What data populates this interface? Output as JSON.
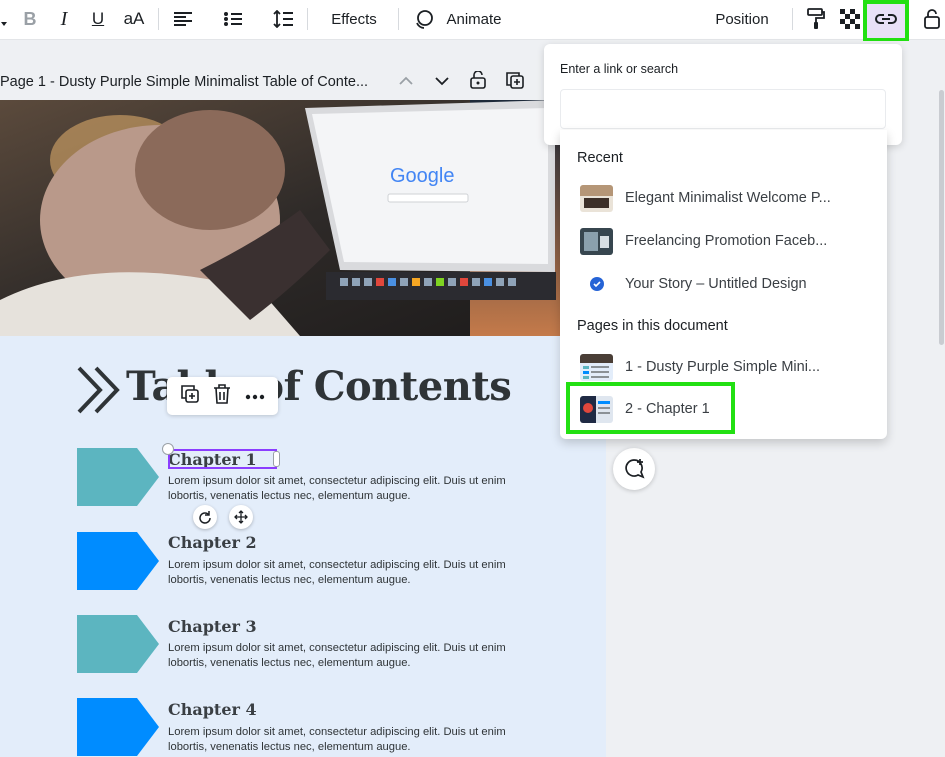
{
  "toolbar": {
    "effects_label": "Effects",
    "animate_label": "Animate",
    "position_label": "Position",
    "font_size_label": "aA",
    "bold_label": "B",
    "italic_label": "I",
    "underline_label": "U",
    "icons": [
      "text-color-icon",
      "bold-icon",
      "italic-icon",
      "underline-icon",
      "case-icon",
      "align-left-icon",
      "bulleted-list-icon",
      "line-spacing-icon",
      "animate-icon",
      "paint-roller-icon",
      "transparency-icon",
      "link-icon",
      "lock-icon"
    ]
  },
  "page_header": {
    "title": "Page 1 - Dusty Purple Simple Minimalist Table of Conte..."
  },
  "canvas": {
    "photo_brand_text": "Google",
    "title": "Table of Contents",
    "chapters": [
      {
        "title": "Chapter 1",
        "body": "Lorem ipsum dolor sit amet, consectetur adipiscing elit. Duis ut enim lobortis, venenatis lectus nec, elementum augue.",
        "color": "#5cb5c0"
      },
      {
        "title": "Chapter 2",
        "body": "Lorem ipsum dolor sit amet, consectetur adipiscing elit. Duis ut enim lobortis, venenatis lectus nec, elementum augue.",
        "color": "#008cff"
      },
      {
        "title": "Chapter 3",
        "body": "Lorem ipsum dolor sit amet, consectetur adipiscing elit. Duis ut enim lobortis, venenatis lectus nec, elementum augue.",
        "color": "#5cb5c0"
      },
      {
        "title": "Chapter 4",
        "body": "Lorem ipsum dolor sit amet, consectetur adipiscing elit. Duis ut enim lobortis, venenatis lectus nec, elementum augue.",
        "color": "#008cff"
      }
    ]
  },
  "link_popup": {
    "label": "Enter a link or search",
    "search_value": "",
    "search_placeholder": "",
    "recent_heading": "Recent",
    "recent_items": [
      {
        "label": "Elegant Minimalist Welcome P..."
      },
      {
        "label": "Freelancing Promotion Faceb..."
      },
      {
        "label": "Your Story – Untitled Design"
      }
    ],
    "pages_heading": "Pages in this document",
    "page_items": [
      {
        "label": "1 - Dusty Purple Simple Mini..."
      },
      {
        "label": "2 - Chapter 1"
      }
    ]
  },
  "colors": {
    "highlight": "#22e012",
    "selection": "#8b3dff",
    "accent_blue": "#008cff",
    "accent_teal": "#5cb5c0",
    "page_bg": "#e3edfa"
  }
}
